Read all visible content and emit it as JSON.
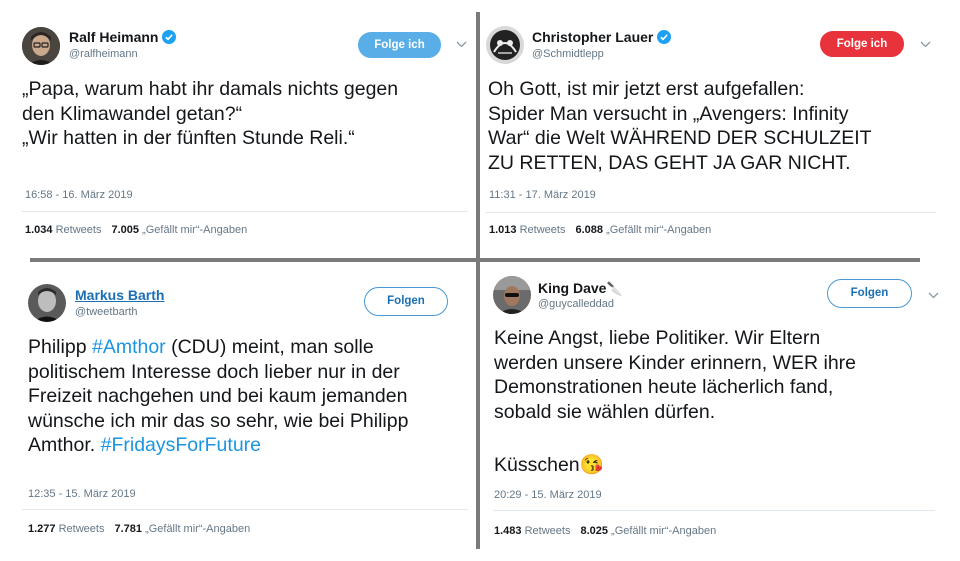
{
  "tweets": [
    {
      "name": "Ralf Heimann",
      "handle": "@ralfheimann",
      "button": "Folge ich",
      "body_lines": [
        "„Papa, warum habt ihr damals nichts gegen",
        "den Klimawandel getan?“",
        "„Wir hatten in der fünften Stunde Reli.“"
      ],
      "time": "16:58 - 16. März 2019",
      "retweets": "1.034",
      "retweets_label": "Retweets",
      "likes": "7.005",
      "likes_label": "„Gefällt mir“-Angaben"
    },
    {
      "name": "Christopher Lauer",
      "handle": "@Schmidtlepp",
      "button": "Folge ich",
      "body_lines": [
        "Oh Gott, ist mir jetzt erst aufgefallen:",
        "Spider Man versucht in „Avengers: Infinity",
        "War“ die Welt WÄHREND DER SCHULZEIT",
        "ZU RETTEN, DAS GEHT JA GAR NICHT."
      ],
      "time": "11:31 - 17. März 2019",
      "retweets": "1.013",
      "retweets_label": "Retweets",
      "likes": "6.088",
      "likes_label": "„Gefällt mir“-Angaben"
    },
    {
      "name": "Markus Barth",
      "handle": "@tweetbarth",
      "button": "Folgen",
      "body": {
        "p1": "Philipp ",
        "tag1": "#Amthor",
        "p2": " (CDU) meint, man solle politischem Interesse doch lieber nur in der Freizeit nachgehen und bei kaum jemanden wünsche ich mir das so sehr, wie bei  Philipp Amthor. ",
        "tag2": "#FridaysForFuture"
      },
      "time": "12:35 - 15. März 2019",
      "retweets": "1.277",
      "retweets_label": "Retweets",
      "likes": "7.781",
      "likes_label": "„Gefällt mir“-Angaben"
    },
    {
      "name": "King Dave",
      "name_emoji": "🔪",
      "handle": "@guycalleddad",
      "button": "Folgen",
      "body_lines": [
        "Keine Angst, liebe Politiker. Wir Eltern",
        "werden unsere Kinder erinnern, WER ihre",
        "Demonstrationen heute lächerlich fand,",
        "sobald sie wählen dürfen."
      ],
      "closing": "Küsschen",
      "closing_emoji": "😘",
      "time": "20:29 - 15. März 2019",
      "retweets": "1.483",
      "retweets_label": "Retweets",
      "likes": "8.025",
      "likes_label": "„Gefällt mir“-Angaben"
    }
  ],
  "colors": {
    "blue_button": "#5aaee8",
    "red_button": "#e8323c",
    "hashtag": "#1b95e0",
    "divider": "#7a7a7a"
  }
}
